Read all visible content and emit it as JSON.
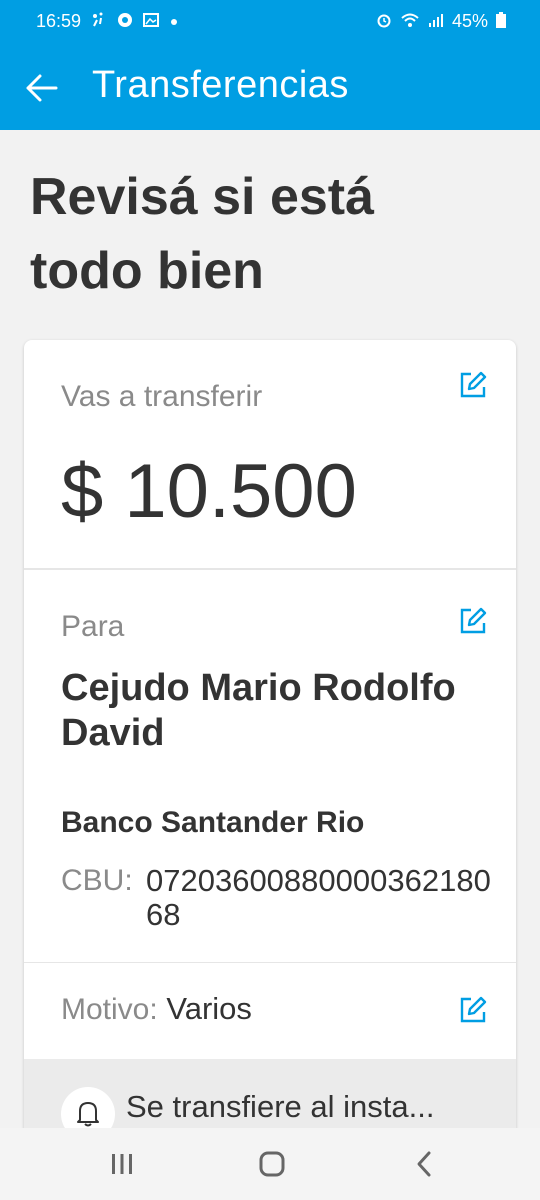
{
  "status_bar": {
    "time": "16:59",
    "battery": "45%",
    "icons": [
      "notification-dots-icon",
      "chrome-icon",
      "image-icon",
      "dot-icon",
      "alarm-icon",
      "wifi-icon",
      "signal-icon",
      "battery-icon"
    ]
  },
  "app_bar": {
    "title": "Transferencias",
    "back_icon": "arrow-left-icon"
  },
  "page": {
    "heading": "Revisá si está todo bien"
  },
  "transfer": {
    "amount_label": "Vas a transferir",
    "amount": "$ 10.500",
    "to_label": "Para",
    "recipient": "Cejudo Mario Rodolfo David",
    "bank": "Banco Santander Rio",
    "cbu_label": "CBU:",
    "cbu": "0720360088000036218068",
    "reason_label": "Motivo:",
    "reason": "Varios",
    "instant_text": "Se transfiere al insta..."
  },
  "colors": {
    "brand": "#009ee3",
    "text_dark": "#333333",
    "text_gray": "#8a8a8a",
    "edit_icon": "#009ee3"
  },
  "nav_bar": {
    "icons": [
      "recent-apps-icon",
      "home-icon",
      "back-icon"
    ]
  }
}
